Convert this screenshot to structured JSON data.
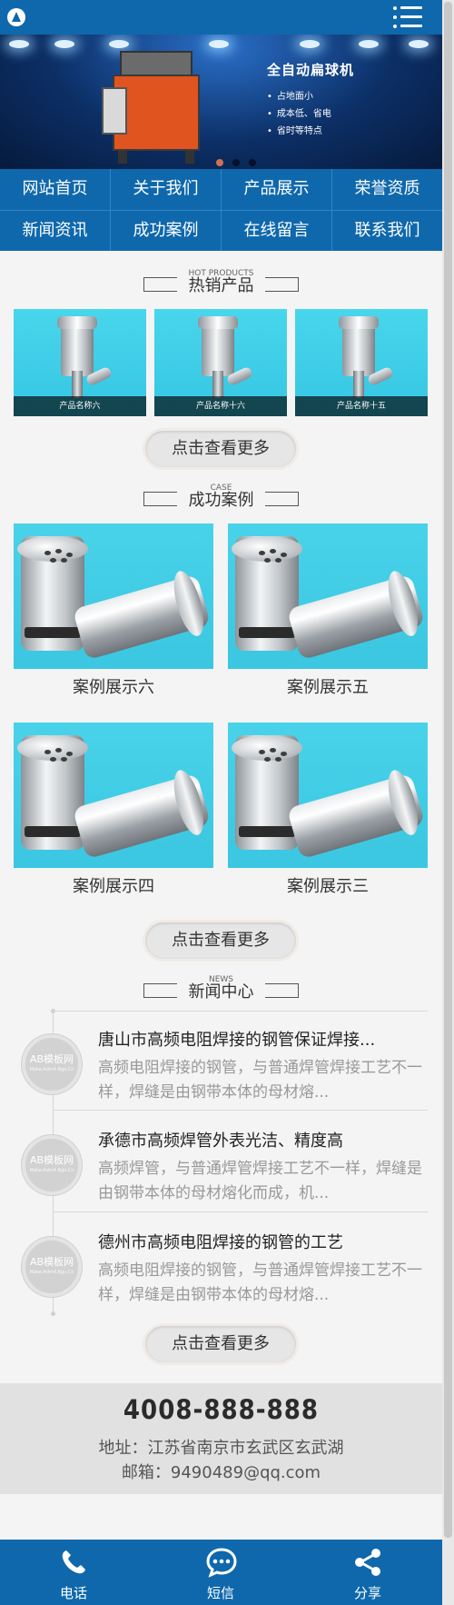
{
  "header": {
    "logo_icon": "site-logo-icon",
    "menu_icon": "menu-icon"
  },
  "banner": {
    "title": "全自动扁球机",
    "points": [
      "占地面小",
      "成本低、省电",
      "省时等特点"
    ],
    "slides": 3,
    "active_slide": 1
  },
  "nav": {
    "items": [
      "网站首页",
      "关于我们",
      "产品展示",
      "荣誉资质",
      "新闻资讯",
      "成功案例",
      "在线留言",
      "联系我们"
    ]
  },
  "hot_products": {
    "title_en": "HOT PRODUCTS",
    "title_cn": "热销产品",
    "items": [
      {
        "caption": "产品名称六"
      },
      {
        "caption": "产品名称十六"
      },
      {
        "caption": "产品名称十五"
      }
    ],
    "more_label": "点击查看更多"
  },
  "cases": {
    "title_en": "CASE",
    "title_cn": "成功案例",
    "items": [
      {
        "label": "案例展示六"
      },
      {
        "label": "案例展示五"
      },
      {
        "label": "案例展示四"
      },
      {
        "label": "案例展示三"
      }
    ],
    "more_label": "点击查看更多"
  },
  "news": {
    "title_en": "NEWS",
    "title_cn": "新闻中心",
    "thumb_text": "AB模板网",
    "thumb_sub": "Make.Adm4.Bgo.Cn",
    "items": [
      {
        "title": "唐山市高频电阻焊接的钢管保证焊接...",
        "desc": "高频电阻焊接的钢管，与普通焊管焊接工艺不一样，焊缝是由钢带本体的母材熔..."
      },
      {
        "title": "承德市高频焊管外表光洁、精度高",
        "desc": "高频焊管，与普通焊管焊接工艺不一样，焊缝是由钢带本体的母材熔化而成，机..."
      },
      {
        "title": "德州市高频电阻焊接的钢管的工艺",
        "desc": "高频电阻焊接的钢管，与普通焊管焊接工艺不一样，焊缝是由钢带本体的母材熔..."
      }
    ],
    "more_label": "点击查看更多"
  },
  "contact": {
    "phone": "4008-888-888",
    "address": "地址：江苏省南京市玄武区玄武湖",
    "email": "邮箱：9490489@qq.com"
  },
  "footer": {
    "items": [
      {
        "label": "电话",
        "icon": "phone-icon"
      },
      {
        "label": "短信",
        "icon": "sms-icon"
      },
      {
        "label": "分享",
        "icon": "share-icon"
      }
    ]
  },
  "colors": {
    "primary": "#0f68ac",
    "banner_bg": "#0c2f66",
    "product_bg": "#48d6ec",
    "contact_bg": "#e1e1e1"
  }
}
